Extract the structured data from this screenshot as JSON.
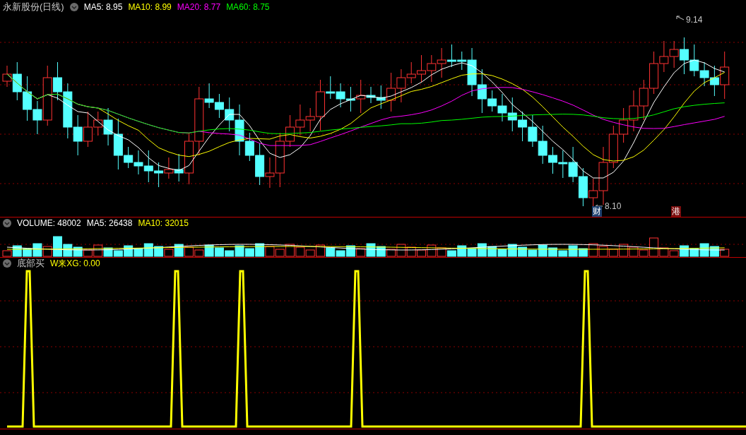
{
  "main_panel": {
    "title": "永新股份(日线)",
    "indicators": [
      {
        "label": "MA5: 8.95",
        "color": "#ffffff"
      },
      {
        "label": "MA10: 8.99",
        "color": "#ffff00"
      },
      {
        "label": "MA20: 8.77",
        "color": "#ff00ff"
      },
      {
        "label": "MA60: 8.75",
        "color": "#00ff00"
      }
    ],
    "high_label": "9.14",
    "low_label": "8.10",
    "badges": [
      {
        "text": "财",
        "color": "#1c3f6e"
      },
      {
        "text": "港",
        "color": "#7a0c0c"
      }
    ]
  },
  "volume_panel": {
    "indicators": [
      {
        "label": "VOLUME: 48002",
        "color": "#ffffff"
      },
      {
        "label": "MA5: 26438",
        "color": "#ffffff"
      },
      {
        "label": "MA10: 32015",
        "color": "#ffff00"
      }
    ]
  },
  "signal_panel": {
    "title": "底部买",
    "indicators": [
      {
        "label": "W来XG: 0.00",
        "color": "#ffff00"
      }
    ]
  }
}
